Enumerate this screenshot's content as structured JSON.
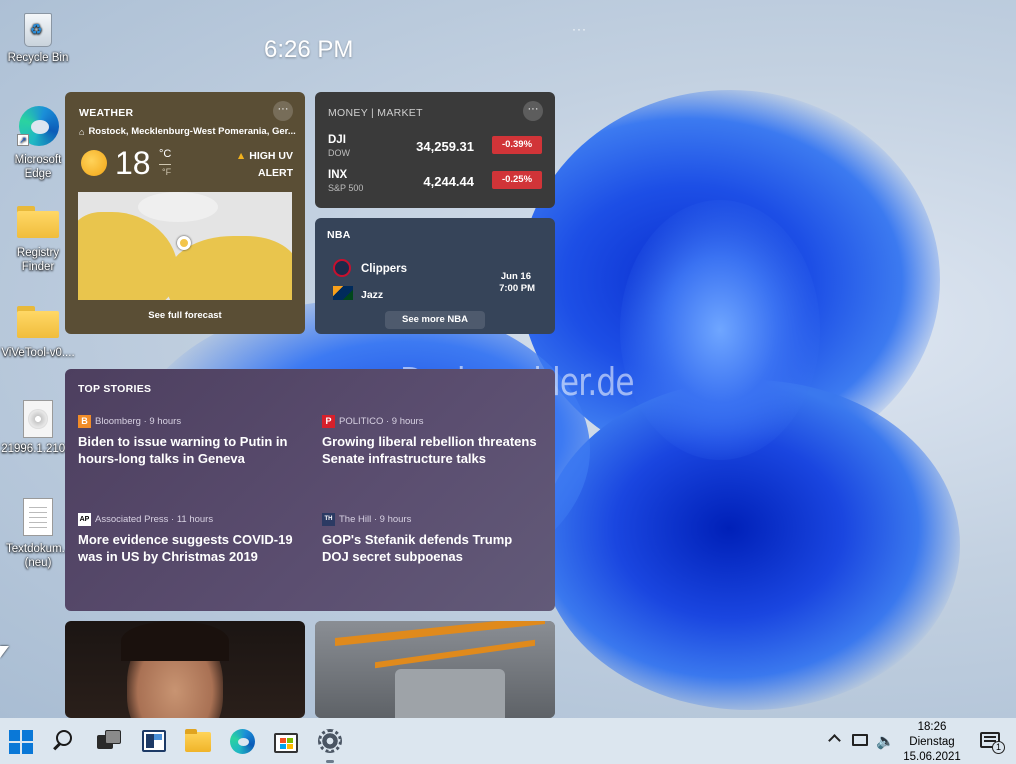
{
  "desktop": {
    "icons": [
      {
        "label": "Recycle Bin"
      },
      {
        "label": "Microsoft Edge"
      },
      {
        "label": "Registry Finder"
      },
      {
        "label": "ViVeTool-v0...."
      },
      {
        "label": "21996.1.210..."
      },
      {
        "label": "Textdokum... (neu)"
      }
    ],
    "watermark": "Deskmodder.de"
  },
  "widgets": {
    "time": "6:26 PM",
    "weather": {
      "title": "WEATHER",
      "location": "Rostock, Mecklenburg-West Pomerania, Ger...",
      "temperature": "18",
      "unit_c": "°C",
      "unit_f": "°F",
      "alert_line1": "HIGH UV",
      "alert_line2": "ALERT",
      "forecast_button": "See full forecast"
    },
    "market": {
      "title": "MONEY | MARKET",
      "stocks": [
        {
          "symbol": "DJI",
          "name": "DOW",
          "price": "34,259.31",
          "change": "-0.39%"
        },
        {
          "symbol": "INX",
          "name": "S&P 500",
          "price": "4,244.44",
          "change": "-0.25%"
        }
      ]
    },
    "nba": {
      "title": "NBA",
      "team1": "Clippers",
      "team2": "Jazz",
      "date": "Jun 16",
      "time": "7:00 PM",
      "more_button": "See more NBA"
    },
    "top_stories": {
      "title": "TOP STORIES",
      "items": [
        {
          "source": "Bloomberg · 9 hours",
          "headline": "Biden to issue warning to Putin in hours-long talks in Geneva",
          "logo": "B"
        },
        {
          "source": "POLITICO · 9 hours",
          "headline": "Growing liberal rebellion threatens Senate infrastructure talks",
          "logo": "P"
        },
        {
          "source": "Associated Press · 11 hours",
          "headline": "More evidence suggests COVID-19 was in US by Christmas 2019",
          "logo": "AP"
        },
        {
          "source": "The Hill · 9 hours",
          "headline": "GOP's Stefanik defends Trump DOJ secret subpoenas",
          "logo": "TH"
        }
      ]
    }
  },
  "taskbar": {
    "clock_time": "18:26",
    "clock_day": "Dienstag",
    "clock_date": "15.06.2021",
    "notification_count": "1"
  },
  "colors": {
    "negative_badge": "#d13438",
    "weather_card": "#5a4e35",
    "market_card": "#3a3a3a",
    "nba_card": "#364459",
    "taskbar": "#dce6ef"
  }
}
